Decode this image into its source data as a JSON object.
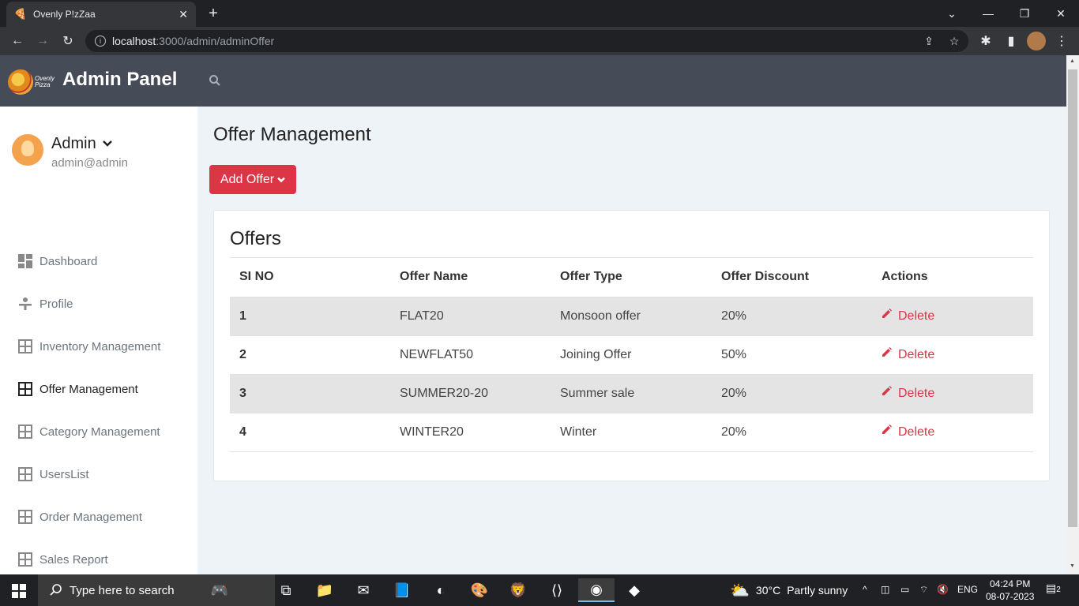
{
  "browser": {
    "tab_title": "Ovenly P!zZaa",
    "url_host": "localhost",
    "url_path": ":3000/admin/adminOffer"
  },
  "header": {
    "logo_text_line1": "Ovenly",
    "logo_text_line2": "Pizza",
    "brand": "Admin Panel"
  },
  "sidebar": {
    "user": {
      "name": "Admin",
      "email": "admin@admin"
    },
    "items": [
      {
        "label": "Dashboard",
        "icon": "dashboard-icon"
      },
      {
        "label": "Profile",
        "icon": "profile-icon"
      },
      {
        "label": "Inventory Management",
        "icon": "grid-icon"
      },
      {
        "label": "Offer Management",
        "icon": "grid-icon",
        "active": true
      },
      {
        "label": "Category Management",
        "icon": "grid-icon"
      },
      {
        "label": "UsersList",
        "icon": "grid-icon"
      },
      {
        "label": "Order Management",
        "icon": "grid-icon"
      },
      {
        "label": "Sales Report",
        "icon": "grid-icon"
      }
    ]
  },
  "main": {
    "title": "Offer Management",
    "add_button": "Add Offer",
    "card_title": "Offers",
    "columns": [
      "SI NO",
      "Offer Name",
      "Offer Type",
      "Offer Discount",
      "Actions"
    ],
    "rows": [
      {
        "sino": "1",
        "name": "FLAT20",
        "type": "Monsoon offer",
        "discount": "20%",
        "action": "Delete"
      },
      {
        "sino": "2",
        "name": "NEWFLAT50",
        "type": "Joining Offer",
        "discount": "50%",
        "action": "Delete"
      },
      {
        "sino": "3",
        "name": "SUMMER20-20",
        "type": "Summer sale",
        "discount": "20%",
        "action": "Delete"
      },
      {
        "sino": "4",
        "name": "WINTER20",
        "type": "Winter",
        "discount": "20%",
        "action": "Delete"
      }
    ]
  },
  "taskbar": {
    "search_placeholder": "Type here to search",
    "weather_temp": "30°C",
    "weather_desc": "Partly sunny",
    "lang": "ENG",
    "time": "04:24 PM",
    "date": "08-07-2023",
    "notifications": "2"
  },
  "colors": {
    "accent": "#dc3545",
    "header_bg": "#454b57",
    "page_bg": "#eef3f7"
  }
}
